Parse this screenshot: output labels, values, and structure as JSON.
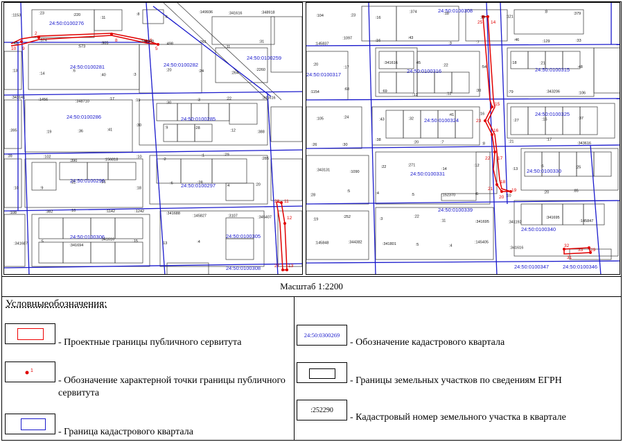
{
  "scale_text": "Масштаб 1:2200",
  "legend": {
    "title": "Условныеобозначения:",
    "items": {
      "red_border": "- Проектные  границы публичного сервитута",
      "red_point_sample": "1",
      "red_point": "- Обозначение характерной точки границы публичного сервитута",
      "blue_border": "- Граница кадастрового квартала",
      "quarter_sample": "24:50:0300269",
      "quarter": "- Обозначение кадастрового квартала",
      "black_border": "- Границы земельных участков по сведениям ЕГРН",
      "parcel_sample": ":252290",
      "parcel": "- Кадастровый номер земельного участка в квартале"
    }
  },
  "colors": {
    "quarter_border": "#1a1acc",
    "servitude": "#e00000",
    "parcel": "#000000"
  },
  "left_map": {
    "quarters": [
      "24:50:0100276",
      "24:50:0100281",
      "24:50:0100282",
      "24:50:0100259",
      "24:50:0100286",
      "24:50:0100285",
      "24:50:0100296",
      "24:50:0100297",
      "24:50:0100306",
      "24:50:0100305",
      "24:50:0100308"
    ],
    "parcels": [
      ":1153",
      ":23",
      ":220",
      ":11",
      ":8",
      ":6",
      ":149936",
      ":341616",
      ":348918",
      ":42",
      ":574",
      ":573",
      ":905",
      ":348909",
      ":498",
      ":261",
      ":11",
      ":31",
      ":13",
      ":14",
      ":6",
      ":40",
      ":3",
      ":20",
      ":24",
      ":264",
      ":2260",
      ":343141",
      ":1456",
      ":348710",
      ":17",
      ":19",
      ":30",
      ":3",
      ":22",
      ":341616",
      ":395",
      ":19",
      ":36",
      ":41",
      ":30",
      ":9",
      ":28",
      ":12",
      ":388",
      ":39",
      ":102",
      ":390",
      ":156818",
      ":10",
      ":2",
      ":1",
      ":29",
      ":285",
      ":10",
      ":9",
      ":31",
      ":21",
      ":18",
      ":6",
      ":28",
      ":4",
      ":20",
      ":108",
      ":382",
      ":10",
      ":1142",
      ":1242",
      ":341688",
      ":145827",
      ":3107",
      ":345407",
      ":341687",
      ":5",
      ":341694",
      ":341616",
      ":15",
      ":13",
      ":4"
    ],
    "points": [
      "2",
      "8",
      "9",
      "10",
      "6",
      "5",
      "28",
      "11",
      "12",
      "13",
      "27"
    ]
  },
  "right_map": {
    "quarters": [
      "24:50:0100308",
      "24:50:0100317",
      "24:50:0100316",
      "24:50:0100315",
      "24:50:0100324",
      "24:50:0100325",
      "24:50:0100331",
      "24:50:0100330",
      "24:50:0100339",
      "24:50:0100340",
      "24:50:0100347",
      "24:50:0100346"
    ],
    "parcels": [
      ":104",
      ":23",
      ":16",
      ":374",
      ":18",
      ":29",
      ":121",
      ":8",
      ":379",
      ":145837",
      ":1097",
      ":16",
      ":43",
      ":3",
      ":7",
      ":46",
      ":129",
      ":33",
      ":20",
      ":17",
      ":341616",
      ":45",
      ":22",
      ":54",
      ":18",
      ":21",
      ":48",
      ":1154",
      ":68",
      ":69",
      ":13",
      ":12",
      ":30",
      ":79",
      ":343206",
      ":106",
      ":105",
      ":24",
      ":43",
      ":32",
      ":41",
      ":16",
      ":27",
      ":16",
      ":37",
      ":26",
      ":30",
      ":38",
      ":20",
      ":7",
      ":8",
      ":21",
      ":17",
      ":343616",
      ":343131",
      ":1090",
      ":22",
      ":271",
      ":14",
      ":12",
      ":13",
      ":6",
      ":25",
      ":28",
      ":5",
      ":4",
      ":5",
      ":152370",
      ":6",
      ":10",
      ":20",
      ":85",
      ":19",
      ":252",
      ":3",
      ":22",
      ":11",
      ":341695",
      ":341192",
      ":341695",
      ":145847",
      ":145848",
      ":344382",
      ":341801",
      ":5",
      ":4",
      ":145405",
      ":341616"
    ],
    "points": [
      "25",
      "14",
      "15",
      "23",
      "16",
      "22",
      "17",
      "18",
      "19",
      "20",
      "21",
      "32",
      "33",
      "29",
      "31"
    ]
  }
}
